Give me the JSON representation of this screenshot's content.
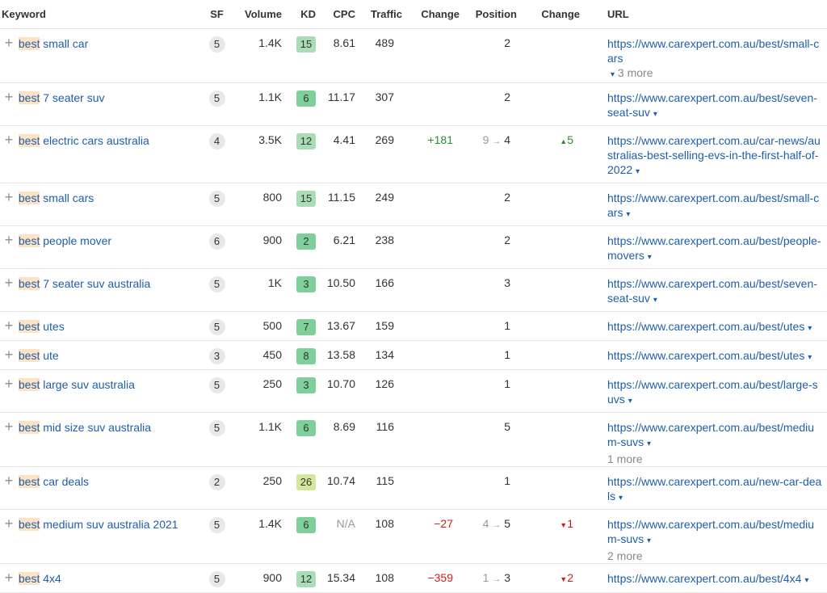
{
  "headers": {
    "keyword": "Keyword",
    "sf": "SF",
    "volume": "Volume",
    "kd": "KD",
    "cpc": "CPC",
    "traffic": "Traffic",
    "change": "Change",
    "position": "Position",
    "pos_change": "Change",
    "url": "URL"
  },
  "icons": {
    "add": "plus-icon",
    "dropdown": "caret-down-icon",
    "up": "triangle-up-icon",
    "down": "triangle-down-icon"
  },
  "colors": {
    "link": "#1f5ea8",
    "highlight": "#fde3c5",
    "positive": "#2d8c2d",
    "negative": "#d41b1b"
  },
  "rows": [
    {
      "highlight": "best",
      "rest": " small car",
      "sf": "5",
      "volume": "1.4K",
      "kd": "15",
      "kd_color": "#a9ddb5",
      "cpc": "8.61",
      "traffic": "489",
      "change": "",
      "position": "2",
      "pos_from": "",
      "pos_change": "",
      "pos_dir": "",
      "url": "https://www.carexpert.com.au/best/small-cars",
      "url_caret": "",
      "more": "3 more"
    },
    {
      "highlight": "best",
      "rest": " 7 seater suv",
      "sf": "5",
      "volume": "1.1K",
      "kd": "6",
      "kd_color": "#7fcf9a",
      "cpc": "11.17",
      "traffic": "307",
      "change": "",
      "position": "2",
      "pos_from": "",
      "pos_change": "",
      "pos_dir": "",
      "url": "https://www.carexpert.com.au/best/seven-seat-suv",
      "url_caret": "▾",
      "more": ""
    },
    {
      "highlight": "best",
      "rest": " electric cars australia",
      "sf": "4",
      "volume": "3.5K",
      "kd": "12",
      "kd_color": "#a9ddb5",
      "cpc": "4.41",
      "traffic": "269",
      "change": "+181",
      "pos_from": "9",
      "position": "4",
      "pos_change": "5",
      "pos_dir": "up",
      "url": "https://www.carexpert.com.au/car-news/australias-best-selling-evs-in-the-first-half-of-2022",
      "url_caret": "▾",
      "more": ""
    },
    {
      "highlight": "best",
      "rest": " small cars",
      "sf": "5",
      "volume": "800",
      "kd": "15",
      "kd_color": "#a9ddb5",
      "cpc": "11.15",
      "traffic": "249",
      "change": "",
      "position": "2",
      "pos_from": "",
      "pos_change": "",
      "pos_dir": "",
      "url": "https://www.carexpert.com.au/best/small-cars",
      "url_caret": "▾",
      "more": ""
    },
    {
      "highlight": "best",
      "rest": " people mover",
      "sf": "6",
      "volume": "900",
      "kd": "2",
      "kd_color": "#7fcf9a",
      "cpc": "6.21",
      "traffic": "238",
      "change": "",
      "position": "2",
      "pos_from": "",
      "pos_change": "",
      "pos_dir": "",
      "url": "https://www.carexpert.com.au/best/people-movers",
      "url_caret": "▾",
      "more": ""
    },
    {
      "highlight": "best",
      "rest": " 7 seater suv australia",
      "sf": "5",
      "volume": "1K",
      "kd": "3",
      "kd_color": "#7fcf9a",
      "cpc": "10.50",
      "traffic": "166",
      "change": "",
      "position": "3",
      "pos_from": "",
      "pos_change": "",
      "pos_dir": "",
      "url": "https://www.carexpert.com.au/best/seven-seat-suv",
      "url_caret": "▾",
      "more": ""
    },
    {
      "highlight": "best",
      "rest": " utes",
      "sf": "5",
      "volume": "500",
      "kd": "7",
      "kd_color": "#7fcf9a",
      "cpc": "13.67",
      "traffic": "159",
      "change": "",
      "position": "1",
      "pos_from": "",
      "pos_change": "",
      "pos_dir": "",
      "url": "https://www.carexpert.com.au/best/utes",
      "url_caret": "▾",
      "more": ""
    },
    {
      "highlight": "best",
      "rest": " ute",
      "sf": "3",
      "volume": "450",
      "kd": "8",
      "kd_color": "#7fcf9a",
      "cpc": "13.58",
      "traffic": "134",
      "change": "",
      "position": "1",
      "pos_from": "",
      "pos_change": "",
      "pos_dir": "",
      "url": "https://www.carexpert.com.au/best/utes",
      "url_caret": "▾",
      "more": ""
    },
    {
      "highlight": "best",
      "rest": " large suv australia",
      "sf": "5",
      "volume": "250",
      "kd": "3",
      "kd_color": "#7fcf9a",
      "cpc": "10.70",
      "traffic": "126",
      "change": "",
      "position": "1",
      "pos_from": "",
      "pos_change": "",
      "pos_dir": "",
      "url": "https://www.carexpert.com.au/best/large-suvs",
      "url_caret": "▾",
      "more": ""
    },
    {
      "highlight": "best",
      "rest": " mid size suv australia",
      "sf": "5",
      "volume": "1.1K",
      "kd": "6",
      "kd_color": "#7fcf9a",
      "cpc": "8.69",
      "traffic": "116",
      "change": "",
      "position": "5",
      "pos_from": "",
      "pos_change": "",
      "pos_dir": "",
      "url": "https://www.carexpert.com.au/best/medium-suvs",
      "url_caret": "▾",
      "more": "1 more"
    },
    {
      "highlight": "best",
      "rest": " car deals",
      "sf": "2",
      "volume": "250",
      "kd": "26",
      "kd_color": "#d3e89a",
      "cpc": "10.74",
      "traffic": "115",
      "change": "",
      "position": "1",
      "pos_from": "",
      "pos_change": "",
      "pos_dir": "",
      "url": "https://www.carexpert.com.au/new-car-deals",
      "url_caret": "▾",
      "more": ""
    },
    {
      "highlight": "best",
      "rest": " medium suv australia 2021",
      "sf": "5",
      "volume": "1.4K",
      "kd": "6",
      "kd_color": "#7fcf9a",
      "cpc": "N/A",
      "traffic": "108",
      "change": "−27",
      "pos_from": "4",
      "position": "5",
      "pos_change": "1",
      "pos_dir": "down",
      "url": "https://www.carexpert.com.au/best/medium-suvs",
      "url_caret": "▾",
      "more": "2 more"
    },
    {
      "highlight": "best",
      "rest": " 4x4",
      "sf": "5",
      "volume": "900",
      "kd": "12",
      "kd_color": "#a9ddb5",
      "cpc": "15.34",
      "traffic": "108",
      "change": "−359",
      "pos_from": "1",
      "position": "3",
      "pos_change": "2",
      "pos_dir": "down",
      "url": "https://www.carexpert.com.au/best/4x4",
      "url_caret": "▾",
      "more": ""
    }
  ]
}
